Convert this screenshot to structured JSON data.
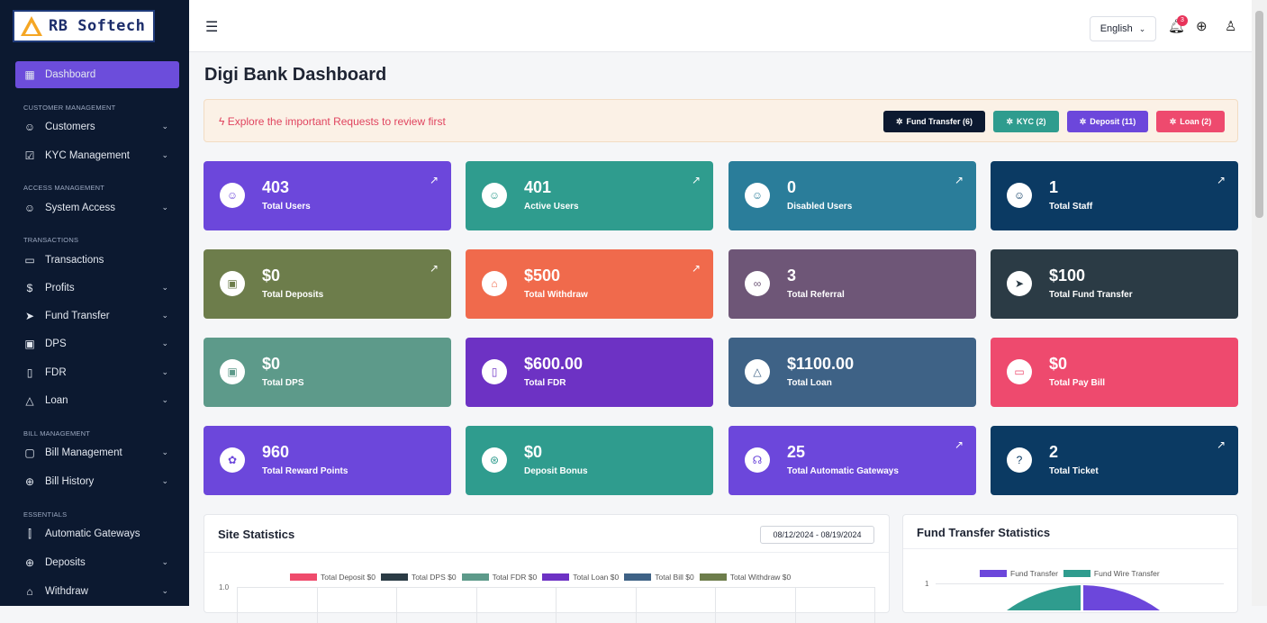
{
  "brand": {
    "name": "RB Softech"
  },
  "sidebar": {
    "dashboard": "Dashboard",
    "sections": {
      "customer": "CUSTOMER MANAGEMENT",
      "access": "ACCESS MANAGEMENT",
      "transactions": "TRANSACTIONS",
      "bill": "BILL MANAGEMENT",
      "essentials": "ESSENTIALS"
    },
    "items": {
      "customers": "Customers",
      "kyc": "KYC Management",
      "system_access": "System Access",
      "transactions": "Transactions",
      "profits": "Profits",
      "fund_transfer": "Fund Transfer",
      "dps": "DPS",
      "fdr": "FDR",
      "loan": "Loan",
      "bill_management": "Bill Management",
      "bill_history": "Bill History",
      "auto_gateways": "Automatic Gateways",
      "deposits": "Deposits",
      "withdraw": "Withdraw"
    }
  },
  "topbar": {
    "language": "English",
    "notification_count": "3"
  },
  "page": {
    "title": "Digi Bank Dashboard"
  },
  "alert": {
    "text": "Explore the important Requests to review first",
    "pills": {
      "fund_transfer": "Fund Transfer (6)",
      "kyc": "KYC (2)",
      "deposit": "Deposit (11)",
      "loan": "Loan (2)"
    }
  },
  "cards": [
    {
      "value": "403",
      "label": "Total Users",
      "color": "#6c47db"
    },
    {
      "value": "401",
      "label": "Active Users",
      "color": "#2f9c8e"
    },
    {
      "value": "0",
      "label": "Disabled Users",
      "color": "#2a7d9a"
    },
    {
      "value": "1",
      "label": "Total Staff",
      "color": "#0b3a63"
    },
    {
      "value": "$0",
      "label": "Total Deposits",
      "color": "#6d7d4b"
    },
    {
      "value": "$500",
      "label": "Total Withdraw",
      "color": "#f06a4c"
    },
    {
      "value": "3",
      "label": "Total Referral",
      "color": "#6e5677"
    },
    {
      "value": "$100",
      "label": "Total Fund Transfer",
      "color": "#2b3b45"
    },
    {
      "value": "$0",
      "label": "Total DPS",
      "color": "#5d9a8a"
    },
    {
      "value": "$600.00",
      "label": "Total FDR",
      "color": "#6d32c4"
    },
    {
      "value": "$1100.00",
      "label": "Total Loan",
      "color": "#3e6286"
    },
    {
      "value": "$0",
      "label": "Total Pay Bill",
      "color": "#ee4a6e"
    },
    {
      "value": "960",
      "label": "Total Reward Points",
      "color": "#6c47db"
    },
    {
      "value": "$0",
      "label": "Deposit Bonus",
      "color": "#2f9c8e"
    },
    {
      "value": "25",
      "label": "Total Automatic Gateways",
      "color": "#6c47db"
    },
    {
      "value": "2",
      "label": "Total Ticket",
      "color": "#0b3a63"
    }
  ],
  "site_stats": {
    "title": "Site Statistics",
    "date_range": "08/12/2024 - 08/19/2024",
    "y_top": "1.0",
    "legend": [
      {
        "name": "Total Deposit $0",
        "color": "#ef4b6c"
      },
      {
        "name": "Total DPS $0",
        "color": "#2b3b45"
      },
      {
        "name": "Total FDR $0",
        "color": "#5d9a8a"
      },
      {
        "name": "Total Loan $0",
        "color": "#6d32c4"
      },
      {
        "name": "Total Bill $0",
        "color": "#3e6286"
      },
      {
        "name": "Total Withdraw $0",
        "color": "#6d7d4b"
      }
    ]
  },
  "fund_stats": {
    "title": "Fund Transfer Statistics",
    "y_top": "1",
    "legend": [
      {
        "name": "Fund Transfer",
        "color": "#6c47db"
      },
      {
        "name": "Fund Wire Transfer",
        "color": "#2f9c8e"
      }
    ]
  }
}
